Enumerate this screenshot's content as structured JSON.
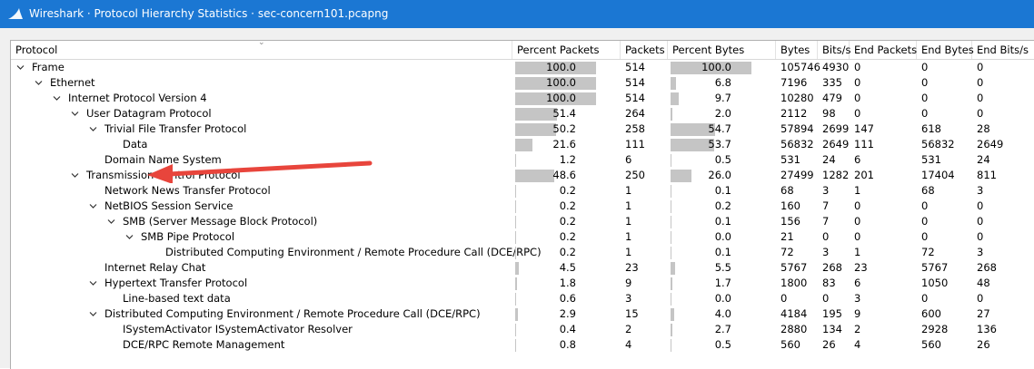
{
  "window": {
    "title": "Wireshark · Protocol Hierarchy Statistics · sec-concern101.pcapng"
  },
  "columns": [
    "Protocol",
    "Percent Packets",
    "Packets",
    "Percent Bytes",
    "Bytes",
    "Bits/s",
    "End Packets",
    "End Bytes",
    "End Bits/s"
  ],
  "colors": {
    "titlebar": "#1b77d3",
    "bar": "#c5c5c5",
    "arrow": "#e8453c"
  },
  "rows": [
    {
      "name": "Frame",
      "depth": 0,
      "expand": true,
      "pp": "100.0",
      "pkts": "514",
      "pb": "100.0",
      "bytes": "105746",
      "bps": "4930",
      "ep": "0",
      "eb": "0",
      "ebps": "0"
    },
    {
      "name": "Ethernet",
      "depth": 1,
      "expand": true,
      "pp": "100.0",
      "pkts": "514",
      "pb": "6.8",
      "bytes": "7196",
      "bps": "335",
      "ep": "0",
      "eb": "0",
      "ebps": "0"
    },
    {
      "name": "Internet Protocol Version 4",
      "depth": 2,
      "expand": true,
      "pp": "100.0",
      "pkts": "514",
      "pb": "9.7",
      "bytes": "10280",
      "bps": "479",
      "ep": "0",
      "eb": "0",
      "ebps": "0"
    },
    {
      "name": "User Datagram Protocol",
      "depth": 3,
      "expand": true,
      "pp": "51.4",
      "pkts": "264",
      "pb": "2.0",
      "bytes": "2112",
      "bps": "98",
      "ep": "0",
      "eb": "0",
      "ebps": "0"
    },
    {
      "name": "Trivial File Transfer Protocol",
      "depth": 4,
      "expand": true,
      "pp": "50.2",
      "pkts": "258",
      "pb": "54.7",
      "bytes": "57894",
      "bps": "2699",
      "ep": "147",
      "eb": "618",
      "ebps": "28"
    },
    {
      "name": "Data",
      "depth": 5,
      "expand": false,
      "pp": "21.6",
      "pkts": "111",
      "pb": "53.7",
      "bytes": "56832",
      "bps": "2649",
      "ep": "111",
      "eb": "56832",
      "ebps": "2649"
    },
    {
      "name": "Domain Name System",
      "depth": 4,
      "expand": false,
      "pp": "1.2",
      "pkts": "6",
      "pb": "0.5",
      "bytes": "531",
      "bps": "24",
      "ep": "6",
      "eb": "531",
      "ebps": "24"
    },
    {
      "name": "Transmission Control Protocol",
      "depth": 3,
      "expand": true,
      "pp": "48.6",
      "pkts": "250",
      "pb": "26.0",
      "bytes": "27499",
      "bps": "1282",
      "ep": "201",
      "eb": "17404",
      "ebps": "811"
    },
    {
      "name": "Network News Transfer Protocol",
      "depth": 4,
      "expand": false,
      "pp": "0.2",
      "pkts": "1",
      "pb": "0.1",
      "bytes": "68",
      "bps": "3",
      "ep": "1",
      "eb": "68",
      "ebps": "3"
    },
    {
      "name": "NetBIOS Session Service",
      "depth": 4,
      "expand": true,
      "pp": "0.2",
      "pkts": "1",
      "pb": "0.2",
      "bytes": "160",
      "bps": "7",
      "ep": "0",
      "eb": "0",
      "ebps": "0"
    },
    {
      "name": "SMB (Server Message Block Protocol)",
      "depth": 5,
      "expand": true,
      "pp": "0.2",
      "pkts": "1",
      "pb": "0.1",
      "bytes": "156",
      "bps": "7",
      "ep": "0",
      "eb": "0",
      "ebps": "0"
    },
    {
      "name": "SMB Pipe Protocol",
      "depth": 6,
      "expand": true,
      "pp": "0.2",
      "pkts": "1",
      "pb": "0.0",
      "bytes": "21",
      "bps": "0",
      "ep": "0",
      "eb": "0",
      "ebps": "0"
    },
    {
      "name": "Distributed Computing Environment / Remote Procedure Call (DCE/RPC)",
      "depth": 8,
      "expand": false,
      "pp": "0.2",
      "pkts": "1",
      "pb": "0.1",
      "bytes": "72",
      "bps": "3",
      "ep": "1",
      "eb": "72",
      "ebps": "3"
    },
    {
      "name": "Internet Relay Chat",
      "depth": 4,
      "expand": false,
      "pp": "4.5",
      "pkts": "23",
      "pb": "5.5",
      "bytes": "5767",
      "bps": "268",
      "ep": "23",
      "eb": "5767",
      "ebps": "268"
    },
    {
      "name": "Hypertext Transfer Protocol",
      "depth": 4,
      "expand": true,
      "pp": "1.8",
      "pkts": "9",
      "pb": "1.7",
      "bytes": "1800",
      "bps": "83",
      "ep": "6",
      "eb": "1050",
      "ebps": "48"
    },
    {
      "name": "Line-based text data",
      "depth": 5,
      "expand": false,
      "pp": "0.6",
      "pkts": "3",
      "pb": "0.0",
      "bytes": "0",
      "bps": "0",
      "ep": "3",
      "eb": "0",
      "ebps": "0"
    },
    {
      "name": "Distributed Computing Environment / Remote Procedure Call (DCE/RPC)",
      "depth": 4,
      "expand": true,
      "pp": "2.9",
      "pkts": "15",
      "pb": "4.0",
      "bytes": "4184",
      "bps": "195",
      "ep": "9",
      "eb": "600",
      "ebps": "27"
    },
    {
      "name": "ISystemActivator ISystemActivator Resolver",
      "depth": 5,
      "expand": false,
      "pp": "0.4",
      "pkts": "2",
      "pb": "2.7",
      "bytes": "2880",
      "bps": "134",
      "ep": "2",
      "eb": "2928",
      "ebps": "136"
    },
    {
      "name": "DCE/RPC Remote Management",
      "depth": 5,
      "expand": false,
      "pp": "0.8",
      "pkts": "4",
      "pb": "0.5",
      "bytes": "560",
      "bps": "26",
      "ep": "4",
      "eb": "560",
      "ebps": "26"
    }
  ]
}
